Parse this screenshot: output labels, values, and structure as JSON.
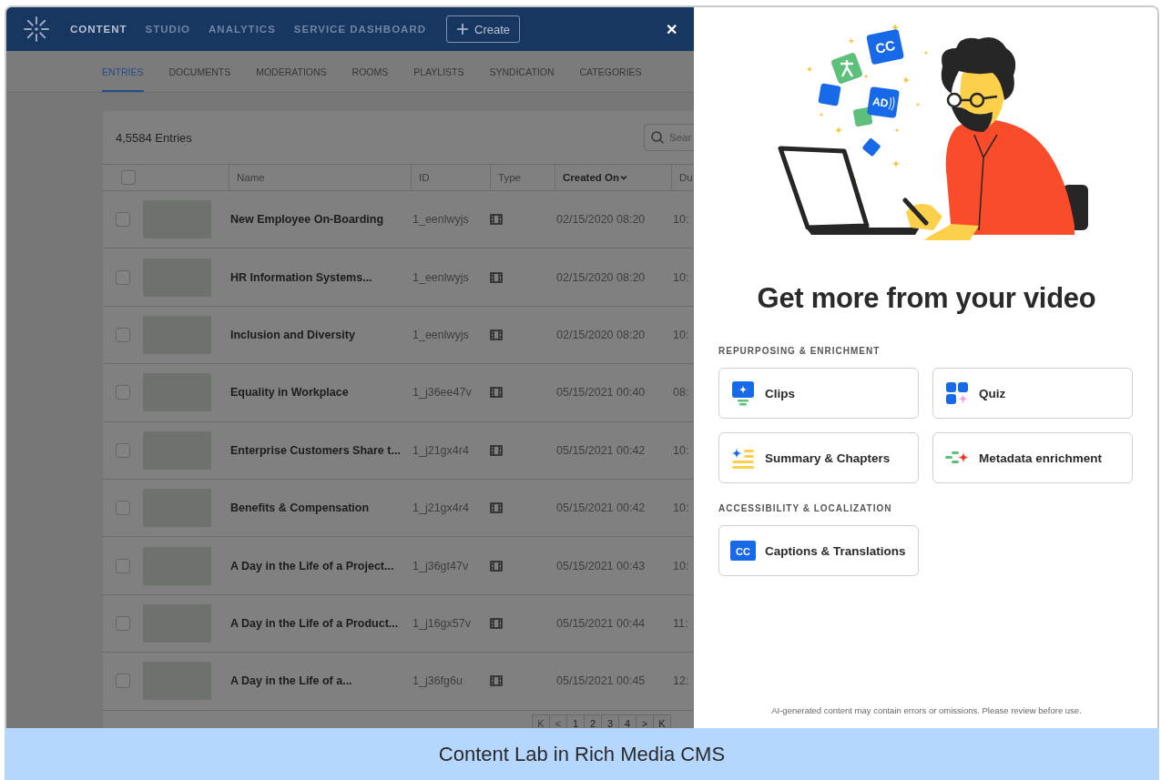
{
  "top_nav": {
    "items": [
      {
        "label": "CONTENT",
        "selected": true
      },
      {
        "label": "STUDIO",
        "selected": false
      },
      {
        "label": "ANALYTICS",
        "selected": false
      },
      {
        "label": "SERVICE DASHBOARD",
        "selected": false
      }
    ],
    "create_button": "Create",
    "close": "✕"
  },
  "sub_tabs": [
    {
      "label": "ENTRIES",
      "selected": true
    },
    {
      "label": "DOCUMENTS",
      "selected": false
    },
    {
      "label": "MODERATIONS",
      "selected": false
    },
    {
      "label": "ROOMS",
      "selected": false
    },
    {
      "label": "PLAYLISTS",
      "selected": false
    },
    {
      "label": "SYNDICATION",
      "selected": false
    },
    {
      "label": "CATEGORIES",
      "selected": false
    }
  ],
  "entries": {
    "count": "4,5584 Entries",
    "search": {
      "placeholder": "Sear"
    },
    "header_checked": false,
    "columns": [
      {
        "label": "Name",
        "sorted": false
      },
      {
        "label": "ID",
        "sorted": false
      },
      {
        "label": "Type",
        "sorted": false
      },
      {
        "label": "Created On",
        "sorted": true
      },
      {
        "label": "Du",
        "sorted": false
      }
    ],
    "rows": [
      {
        "checked": false,
        "name": "New Employee On-Boarding",
        "id": "1_eenlwyjs",
        "kind": "video",
        "created": "02/15/2020 08:20",
        "duration": "10:"
      },
      {
        "checked": false,
        "name": "HR Information Systems...",
        "id": "1_eenlwyjs",
        "kind": "video",
        "created": "02/15/2020 08:20",
        "duration": "10:"
      },
      {
        "checked": false,
        "name": "Inclusion and Diversity",
        "id": "1_eenlwyjs",
        "kind": "video",
        "created": "02/15/2020 08:20",
        "duration": "10:"
      },
      {
        "checked": false,
        "name": "Equality in Workplace",
        "id": "1_j36ee47v",
        "kind": "video",
        "created": "05/15/2021 00:40",
        "duration": "08:"
      },
      {
        "checked": false,
        "name": "Enterprise Customers Share t...",
        "id": "1_j21gx4r4",
        "kind": "video",
        "created": "05/15/2021 00:42",
        "duration": "10:"
      },
      {
        "checked": false,
        "name": "Benefits & Compensation",
        "id": "1_j21gx4r4",
        "kind": "video",
        "created": "05/15/2021 00:42",
        "duration": "10:"
      },
      {
        "checked": false,
        "name": "A Day in the Life of a Project...",
        "id": "1_j36gt47v",
        "kind": "video",
        "created": "05/15/2021 00:43",
        "duration": "10:"
      },
      {
        "checked": false,
        "name": "A Day in the Life of a Product...",
        "id": "1_j16gx57v",
        "kind": "video",
        "created": "05/15/2021 00:44",
        "duration": "11:"
      },
      {
        "checked": false,
        "name": "A Day in the Life of a...",
        "id": "1_j36fg6u",
        "kind": "video",
        "created": "05/15/2021 00:45",
        "duration": "12:"
      }
    ],
    "pagination": [
      {
        "kind": "first",
        "label": "K"
      },
      {
        "kind": "prev",
        "label": "<"
      },
      {
        "kind": "page",
        "label": "1"
      },
      {
        "kind": "page",
        "label": "2"
      },
      {
        "kind": "page",
        "label": "3"
      },
      {
        "kind": "page",
        "label": "4"
      },
      {
        "kind": "next",
        "label": ">"
      },
      {
        "kind": "last",
        "label": "K"
      }
    ]
  },
  "drawer": {
    "badges": [
      "CC",
      "AD"
    ],
    "title": "Get more from your video",
    "sections": [
      {
        "heading": "REPURPOSING & ENRICHMENT",
        "cards": [
          {
            "kind": "clips",
            "label": "Clips"
          },
          {
            "kind": "quiz",
            "label": "Quiz"
          },
          {
            "kind": "summary",
            "label": "Summary & Chapters"
          },
          {
            "kind": "metadata",
            "label": "Metadata enrichment"
          }
        ]
      },
      {
        "heading": "ACCESSIBILITY & LOCALIZATION",
        "cards": [
          {
            "kind": "captions",
            "label": "Captions & Translations",
            "icon_text": "CC"
          }
        ]
      }
    ],
    "disclaimer": "AI-generated content may contain errors or omissions. Please review before use."
  },
  "caption": "Content Lab in Rich Media CMS"
}
